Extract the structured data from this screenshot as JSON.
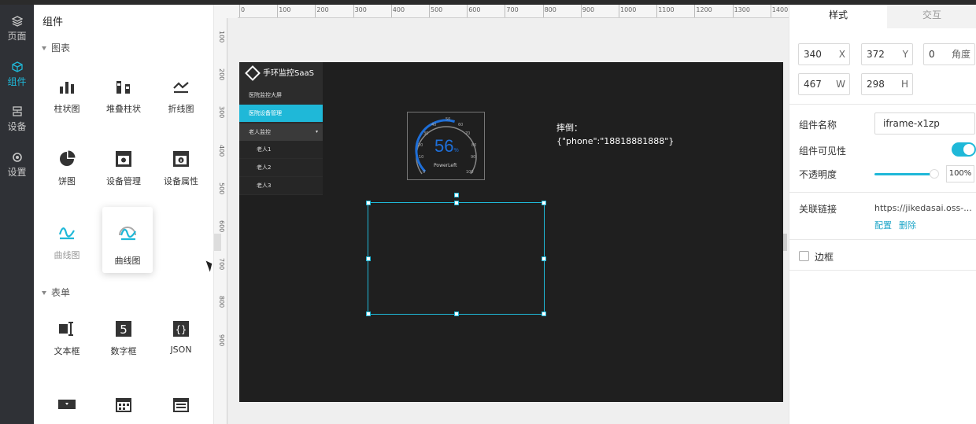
{
  "nav": {
    "items": [
      {
        "label": "页面",
        "icon": "layers-icon"
      },
      {
        "label": "组件",
        "icon": "cube-icon"
      },
      {
        "label": "设备",
        "icon": "device-icon"
      },
      {
        "label": "设置",
        "icon": "gear-icon"
      }
    ]
  },
  "panel": {
    "title": "组件",
    "groups": [
      {
        "title": "图表",
        "items": [
          {
            "label": "柱状图",
            "icon": "bar-chart-icon"
          },
          {
            "label": "堆叠柱状",
            "icon": "stacked-bar-icon"
          },
          {
            "label": "折线图",
            "icon": "line-chart-icon"
          },
          {
            "label": "饼图",
            "icon": "pie-chart-icon"
          },
          {
            "label": "设备管理",
            "icon": "device-manage-icon"
          },
          {
            "label": "设备属性",
            "icon": "device-attr-icon"
          },
          {
            "label": "曲线图",
            "icon": "curve-chart-icon"
          },
          {
            "label": "曲线图",
            "icon": "curve-chart-drag-icon"
          }
        ]
      },
      {
        "title": "表单",
        "items": [
          {
            "label": "文本框",
            "icon": "textbox-icon"
          },
          {
            "label": "数字框",
            "icon": "number-box-icon"
          },
          {
            "label": "JSON",
            "icon": "json-icon"
          },
          {
            "label": "",
            "icon": "dropdown-icon"
          },
          {
            "label": "",
            "icon": "calendar-icon"
          },
          {
            "label": "",
            "icon": "calendar-range-icon"
          }
        ]
      }
    ]
  },
  "ruler": {
    "top_ticks": [
      "0",
      "100",
      "200",
      "300",
      "400",
      "500",
      "600",
      "700",
      "800",
      "900",
      "1000",
      "1100",
      "1200",
      "1300",
      "1400"
    ],
    "left_ticks": [
      "100",
      "200",
      "300",
      "400",
      "500",
      "600",
      "700",
      "800",
      "900"
    ]
  },
  "preview": {
    "brand": "手环监控SaaS",
    "menu": [
      {
        "label": "医院监控大屏"
      },
      {
        "label": "医院设备管理"
      },
      {
        "label": "老人监控"
      },
      {
        "label": "老人1"
      },
      {
        "label": "老人2"
      },
      {
        "label": "老人3"
      }
    ],
    "gauge": {
      "value": "56",
      "unit": "%",
      "caption": "PowerLeft",
      "percent": 56
    },
    "fall_label": "摔倒：",
    "fall_value": "{\"phone\":\"18818881888\"}"
  },
  "inspector": {
    "tabs": [
      "样式",
      "交互"
    ],
    "x": {
      "value": "340",
      "suffix": "X"
    },
    "y": {
      "value": "372",
      "suffix": "Y"
    },
    "angle": {
      "value": "0",
      "suffix": "角度"
    },
    "w": {
      "value": "467",
      "suffix": "W"
    },
    "h": {
      "value": "298",
      "suffix": "H"
    },
    "name_label": "组件名称",
    "name_value": "iframe-x1zp",
    "visible_label": "组件可见性",
    "visible": true,
    "opacity_label": "不透明度",
    "opacity_value": "100%",
    "link_label": "关联链接",
    "link_value": "https://jikedasai.oss-...",
    "config_label": "配置",
    "delete_label": "删除",
    "border_label": "边框"
  },
  "colors": {
    "accent": "#1fb8d8",
    "nav_bg": "#2f3136",
    "canvas_bg": "#1f1f1f",
    "gauge_blue": "#1e6fd9"
  }
}
